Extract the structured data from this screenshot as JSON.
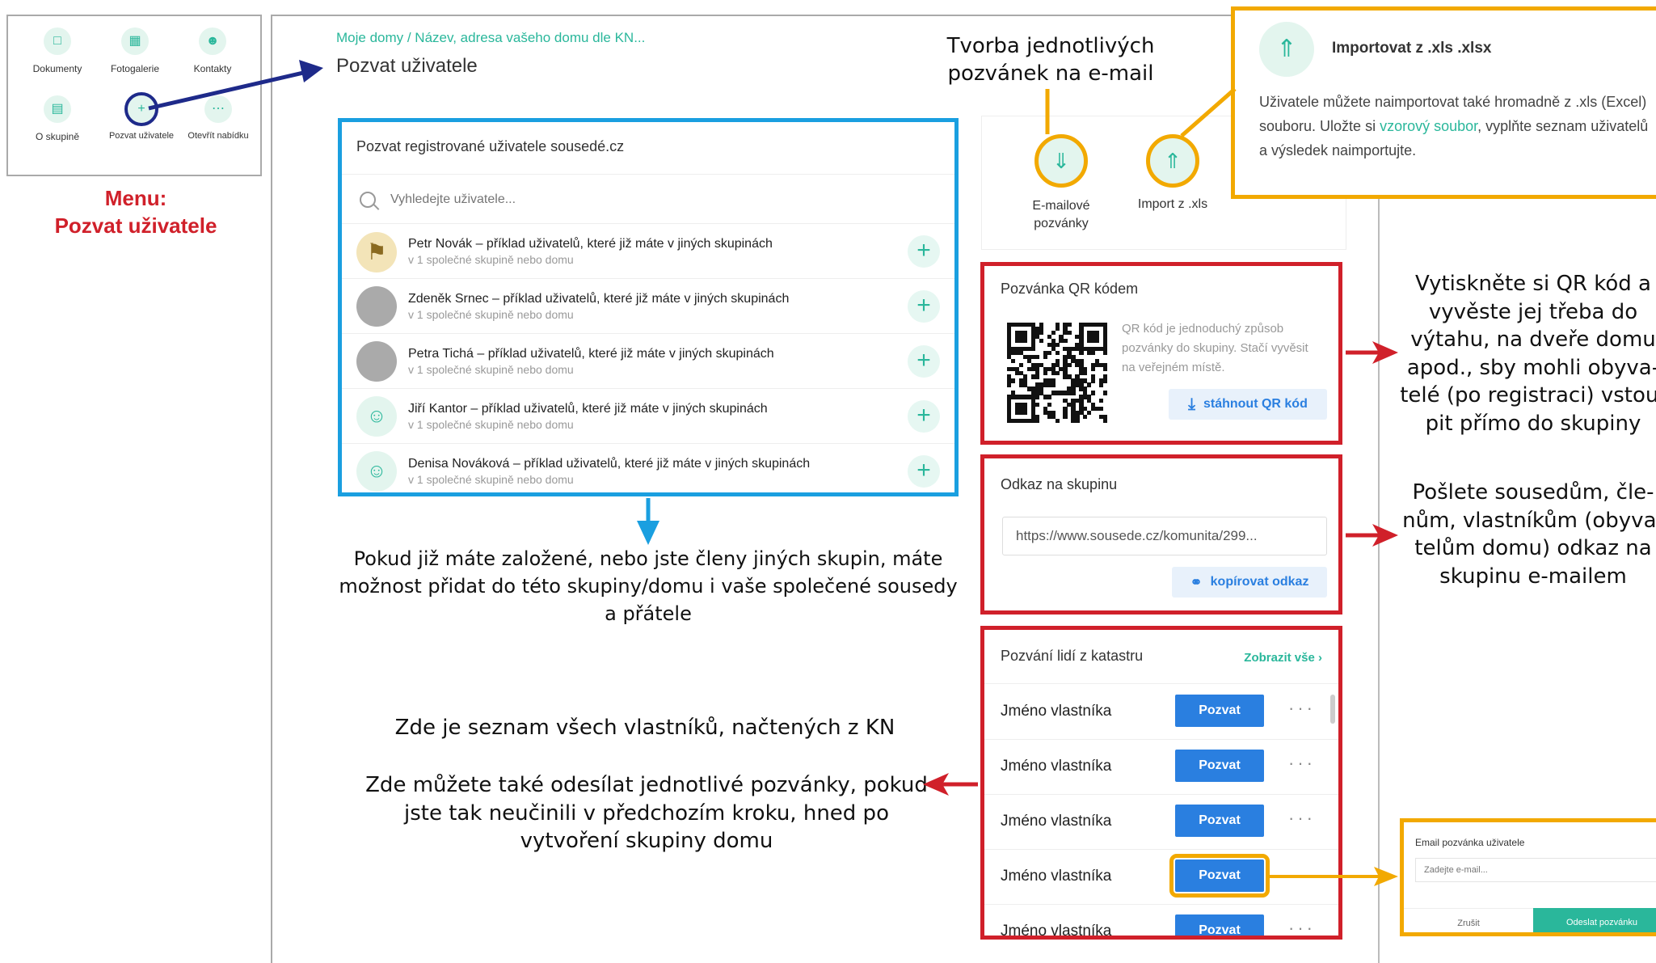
{
  "menu_panel": {
    "items": [
      {
        "label": "Dokumenty",
        "icon": "document-icon"
      },
      {
        "label": "Fotogalerie",
        "icon": "image-icon"
      },
      {
        "label": "Kontakty",
        "icon": "contacts-icon"
      },
      {
        "label": "O skupině",
        "icon": "building-icon"
      },
      {
        "label": "Pozvat uživatele",
        "icon": "add-user-icon"
      },
      {
        "label": "Otevřít nabídku",
        "icon": "more-icon"
      }
    ],
    "caption_line1": "Menu:",
    "caption_line2": "Pozvat uživatele"
  },
  "breadcrumb": "Moje domy / Název, adresa vašeho domu dle KN...",
  "page_title": "Pozvat uživatele",
  "registered_users": {
    "title": "Pozvat registrované uživatele sousedé.cz",
    "search_placeholder": "Vyhledejte uživatele...",
    "users": [
      {
        "name": "Petr Novák – příklad uživatelů, které již máte v jiných skupinách",
        "sub": "v 1 společné skupině nebo domu"
      },
      {
        "name": "Zdeněk Srnec – příklad uživatelů, které již máte v jiných skupinách",
        "sub": "v 1 společné skupině nebo domu"
      },
      {
        "name": "Petra Tichá – příklad uživatelů, které již máte v jiných skupinách",
        "sub": "v 1 společné skupině nebo domu"
      },
      {
        "name": "Jiří Kantor – příklad uživatelů, které již máte v jiných skupinách",
        "sub": "v 1 společné skupině nebo domu"
      },
      {
        "name": "Denisa Nováková – příklad uživatelů, které již máte v jiných skupinách",
        "sub": "v 1 společné skupině nebo domu"
      }
    ]
  },
  "invite_actions": {
    "email_label": "E-mailové pozvánky",
    "import_label": "Import z .xls"
  },
  "import_popup": {
    "title": "Importovat z .xls .xlsx",
    "text_before": "Uživatele můžete naimportovat také hromadně z .xls (Excel) souboru. Uložte si ",
    "link": "vzorový soubor",
    "text_after": ", vyplňte seznam uživatelů a výsledek naimportujte."
  },
  "qr_card": {
    "title": "Pozvánka QR kódem",
    "text": "QR kód je jednoduchý způsob pozvánky do skupiny. Stačí vyvěsit na veřejném místě.",
    "button": "stáhnout QR kód"
  },
  "link_card": {
    "title": "Odkaz na skupinu",
    "url": "https://www.sousede.cz/komunita/299...",
    "button": "kopírovat odkaz"
  },
  "cadastre_card": {
    "title": "Pozvání lidí z katastru",
    "show_all": "Zobrazit vše",
    "rows": [
      {
        "name": "Jméno vlastníka",
        "button": "Pozvat"
      },
      {
        "name": "Jméno vlastníka",
        "button": "Pozvat"
      },
      {
        "name": "Jméno vlastníka",
        "button": "Pozvat"
      },
      {
        "name": "Jméno vlastníka",
        "button": "Pozvat"
      },
      {
        "name": "Jméno vlastníka",
        "button": "Pozvat"
      }
    ]
  },
  "email_popup": {
    "title": "Email pozvánka uživatele",
    "placeholder": "Zadejte e-mail...",
    "cancel": "Zrušit",
    "submit": "Odeslat pozvánku"
  },
  "annotations": {
    "email_invites": "Tvorba jednotlivých pozvánek na e-mail",
    "qr_print": "Vytiskněte si QR kód a vyvěste jej třeba do výtahu, na dveře domu apod., sby mohli obyva-telé (po registraci) vstou-pit přímo do skupiny",
    "link_send": "Pošlete sousedům, čle-nům, vlastníkům (obyva-telům domu) odkaz na skupinu e-mailem",
    "existing_users": "Pokud již máte založené, nebo jste členy jiných skupin, máte možnost přidat do této skupiny/domu i vaše společené sousedy a přátele",
    "owners_list": "Zde je seznam všech  vlastníků, načtených z KN",
    "single_invites": "Zde můžete také odesílat jednotlivé pozvánky, pokud jste tak neučinili v předchozím kroku, hned po vytvoření skupiny domu"
  },
  "colors": {
    "red": "#d0202a",
    "blue": "#1a9fe0",
    "orange": "#f2a900",
    "teal": "#2ab79b",
    "button": "#2a7fe0",
    "navy": "#1e2a8a"
  }
}
